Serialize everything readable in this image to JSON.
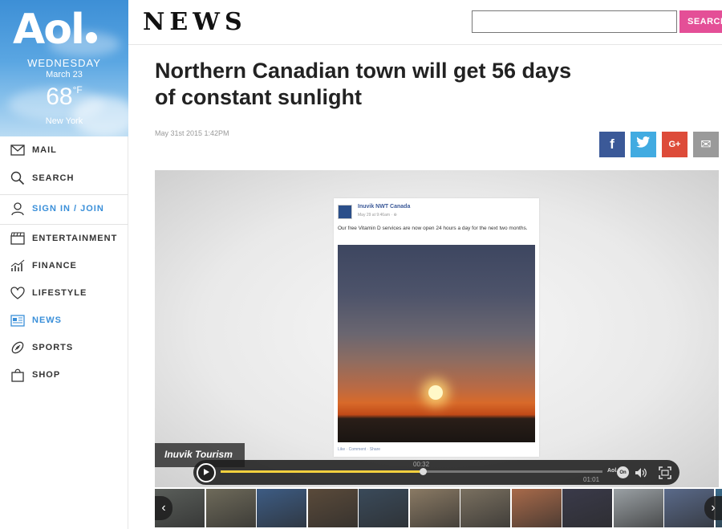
{
  "weather": {
    "day": "WEDNESDAY",
    "date": "March 23",
    "temperature": "68",
    "unit": "°F",
    "city": "New York"
  },
  "brand": {
    "logo_text": "Aol",
    "section_title": "NEWS"
  },
  "sidebar": {
    "items": [
      {
        "label": "MAIL",
        "icon": "mail-icon"
      },
      {
        "label": "SEARCH",
        "icon": "search-icon"
      },
      {
        "label": "SIGN IN / JOIN",
        "icon": "user-icon",
        "active": true
      },
      {
        "label": "ENTERTAINMENT",
        "icon": "clapperboard-icon"
      },
      {
        "label": "FINANCE",
        "icon": "chart-icon"
      },
      {
        "label": "LIFESTYLE",
        "icon": "heart-icon"
      },
      {
        "label": "NEWS",
        "icon": "newspaper-icon",
        "active": true
      },
      {
        "label": "SPORTS",
        "icon": "football-icon"
      },
      {
        "label": "SHOP",
        "icon": "shopping-bag-icon"
      }
    ]
  },
  "search": {
    "value": "",
    "button_label": "SEARCH"
  },
  "article": {
    "headline": "Northern Canadian town will get 56 days of constant sunlight",
    "timestamp": "May 31st 2015 1:42PM",
    "share": [
      {
        "network": "facebook",
        "glyph": "f",
        "color": "#3b5998"
      },
      {
        "network": "twitter",
        "glyph": "t",
        "color": "#41abe1"
      },
      {
        "network": "google-plus",
        "glyph": "G+",
        "color": "#dd4b39"
      },
      {
        "network": "email",
        "glyph": "✉",
        "color": "#9a9a9a"
      }
    ]
  },
  "video": {
    "post": {
      "page_name": "Inuvik NWT Canada",
      "post_time": "May 29 at 9:46am · ⊕",
      "text": "Our free Vitamin D services are now open 24 hours a day for the next two months.",
      "actions": "Like · Comment · Share"
    },
    "caption": "Inuvik Tourism",
    "current_time": "00:32",
    "total_time": "01:01",
    "progress": 0.53,
    "aol_mark": "Aol.",
    "cc_label": "On"
  },
  "thumbnails": {
    "prev_glyph": "‹",
    "next_glyph": "›",
    "colors": [
      "#5a5e5a",
      "#6e6a5a",
      "#3d5c84",
      "#5a4a3a",
      "#3a4a5a",
      "#8a7a64",
      "#7a7060",
      "#a86a4a",
      "#3a3a4a",
      "#9aa0a4",
      "#5a6a8a",
      "#3a6a8a"
    ]
  }
}
